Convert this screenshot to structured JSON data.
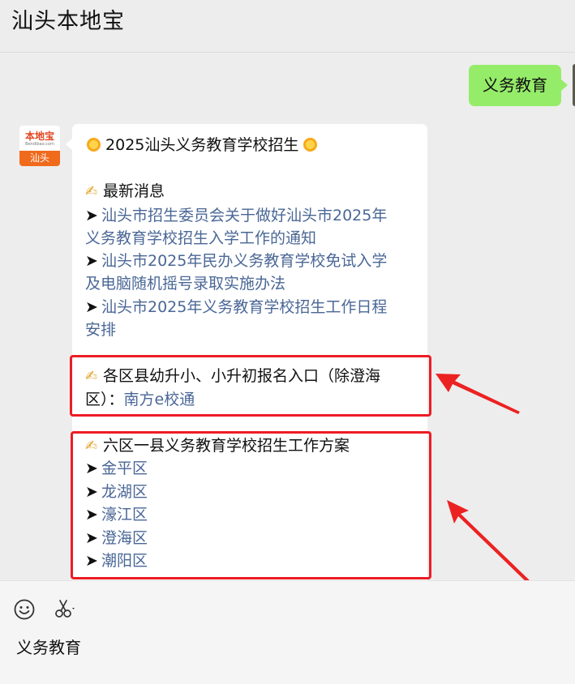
{
  "header": {
    "title": "汕头本地宝"
  },
  "outgoing": {
    "text": "义务教育"
  },
  "bot": {
    "avatar_top": "本地宝",
    "avatar_sub": "Bendibao.com",
    "avatar_band": "汕头"
  },
  "message": {
    "heading": "2025汕头义务教育学校招生",
    "news_title": "最新消息",
    "news_arrow": "➤",
    "news_items": [
      [
        "汕头市招生委员会关于做好汕头市2025年",
        "义务教育学校招生入学工作的通知"
      ],
      [
        "汕头市2025年民办义务教育学校免试入学",
        "及电脑随机摇号录取实施办法"
      ],
      [
        "汕头市2025年义务教育学校招生工作日程",
        "安排"
      ]
    ],
    "reg_title_line1": "各区县幼升小、小升初报名入口（除澄海",
    "reg_title_line2": "区）：",
    "reg_link": "南方e校通",
    "plan_title": "六区一县义务教育学校招生工作方案",
    "districts": [
      "金平区",
      "龙湖区",
      "濠江区",
      "澄海区",
      "潮阳区"
    ]
  },
  "colors": {
    "link": "#4a6796",
    "outgoing_bubble": "#95ec69",
    "highlight_box": "#ec1c24"
  },
  "input": {
    "text": "义务教育"
  },
  "icons": [
    "emoji-icon",
    "scissors-icon",
    "sun-emoji-icon",
    "writing-hand-emoji-icon"
  ]
}
